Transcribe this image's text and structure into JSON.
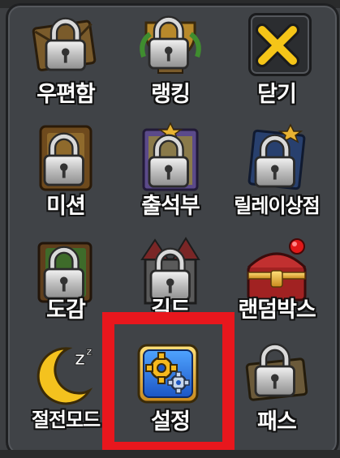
{
  "menu": {
    "items": [
      {
        "label": "우편함",
        "icon": "mail-lock-icon",
        "locked": true
      },
      {
        "label": "랭킹",
        "icon": "ranking-trophy-lock-icon",
        "locked": true
      },
      {
        "label": "닫기",
        "icon": "close-x-icon",
        "locked": false
      },
      {
        "label": "미션",
        "icon": "mission-lock-icon",
        "locked": true
      },
      {
        "label": "출석부",
        "icon": "attendance-lock-icon",
        "locked": true
      },
      {
        "label": "릴레이상점",
        "icon": "relay-shop-lock-icon",
        "locked": true
      },
      {
        "label": "도감",
        "icon": "collection-book-lock-icon",
        "locked": true
      },
      {
        "label": "길드",
        "icon": "guild-castle-lock-icon",
        "locked": true
      },
      {
        "label": "랜덤박스",
        "icon": "random-box-chest-icon",
        "locked": false
      },
      {
        "label": "절전모드",
        "icon": "power-save-moon-icon",
        "locked": false
      },
      {
        "label": "설정",
        "icon": "settings-gear-icon",
        "locked": false
      },
      {
        "label": "패스",
        "icon": "pass-ticket-lock-icon",
        "locked": true
      }
    ]
  },
  "colors": {
    "panel": "#404347",
    "highlight": "#e8171d",
    "close_x": "#f5c518",
    "gear_bg": "#2d6fd6",
    "gold": "#e9b332"
  }
}
